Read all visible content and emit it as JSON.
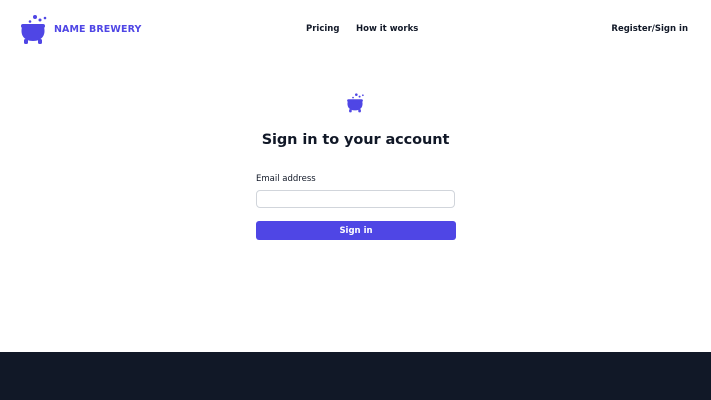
{
  "brand": {
    "name": "NAME BREWERY",
    "logo_icon": "cauldron-icon",
    "color": "#4f46e5"
  },
  "nav": {
    "pricing": "Pricing",
    "how_it_works": "How it works",
    "register": "Register/Sign in"
  },
  "form": {
    "title": "Sign in to your account",
    "email_label": "Email address",
    "email_value": "",
    "email_placeholder": "",
    "submit_label": "Sign in"
  },
  "colors": {
    "accent": "#4f46e5",
    "footer": "#111827",
    "text": "#111827"
  }
}
